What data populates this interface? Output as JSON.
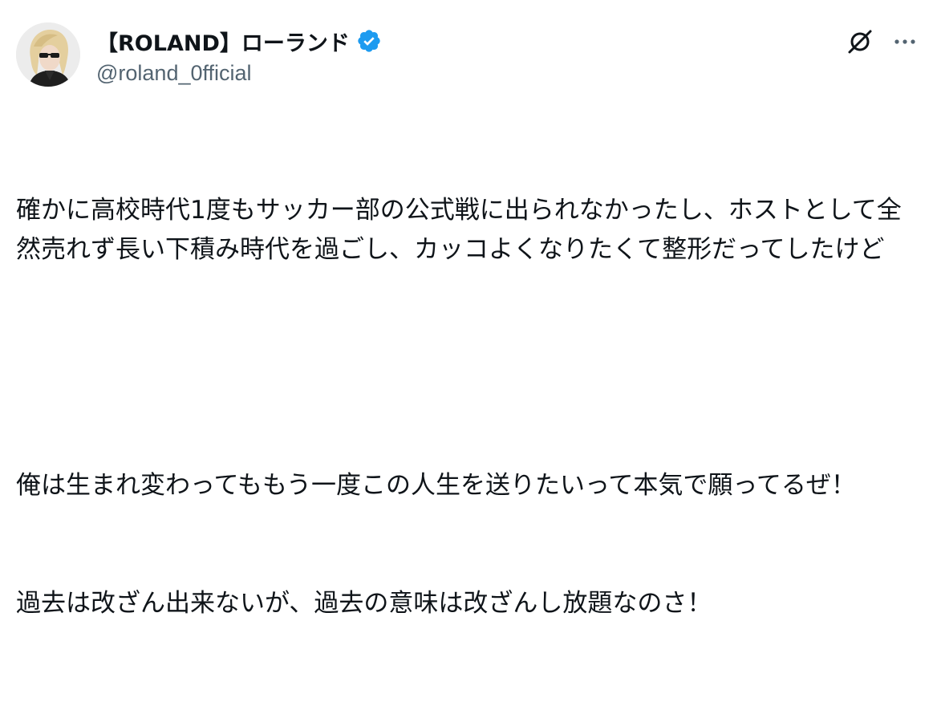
{
  "user": {
    "display_name": "【ROLAND】ローランド",
    "handle": "@roland_0fficial",
    "verified": true,
    "avatar_icon": "profile-photo"
  },
  "actions": {
    "grok_icon": "grok-icon",
    "more_icon": "more-options-icon"
  },
  "tweet": {
    "paragraph1": "確かに高校時代1度もサッカー部の公式戦に出られなかったし、ホストとして全然売れず長い下積み時代を過ごし、カッコよくなりたくて整形だってしたけど",
    "paragraph2_line1": "俺は生まれ変わってももう一度この人生を送りたいって本気で願ってるぜ！",
    "paragraph2_line2": "過去は改ざん出来ないが、過去の意味は改ざんし放題なのさ！"
  },
  "colors": {
    "text": "#0f1419",
    "secondary": "#536471",
    "verified": "#1d9bf0"
  }
}
